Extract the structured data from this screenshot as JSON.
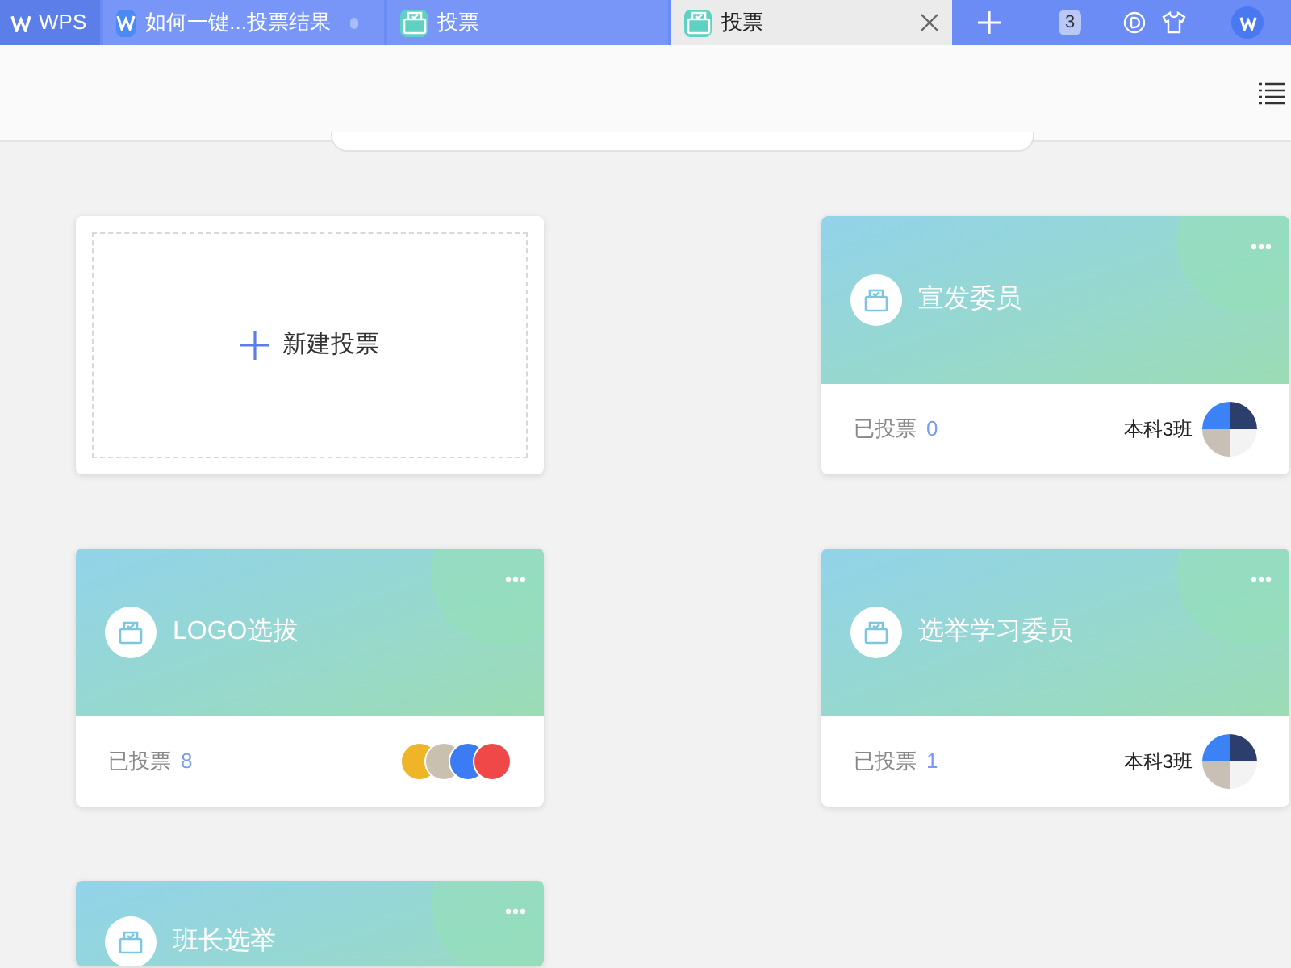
{
  "app_tab": {
    "label": "WPS"
  },
  "tabs": [
    {
      "label": "如何一键...投票结果",
      "kind": "doc",
      "selected": false,
      "modified": true
    },
    {
      "label": "投票",
      "kind": "vote",
      "selected": false,
      "modified": false
    },
    {
      "label": "投票",
      "kind": "vote",
      "selected": true,
      "modified": false
    }
  ],
  "window_count": "3",
  "new_card": {
    "label": "新建投票"
  },
  "polls": [
    {
      "title": "宣发委员",
      "voted_label": "已投票",
      "count": "0",
      "group": "本科3班",
      "avatars": [
        {
          "kind": "group"
        }
      ]
    },
    {
      "title": "LOGO选拔",
      "voted_label": "已投票",
      "count": "8",
      "avatars": [
        {
          "kind": "photo"
        },
        {
          "kind": "photo"
        },
        {
          "kind": "photo"
        },
        {
          "kind": "photo"
        }
      ]
    },
    {
      "title": "选举学习委员",
      "voted_label": "已投票",
      "count": "1",
      "group": "本科3班",
      "avatars": [
        {
          "kind": "group"
        }
      ]
    },
    {
      "title": "班长选举"
    }
  ]
}
